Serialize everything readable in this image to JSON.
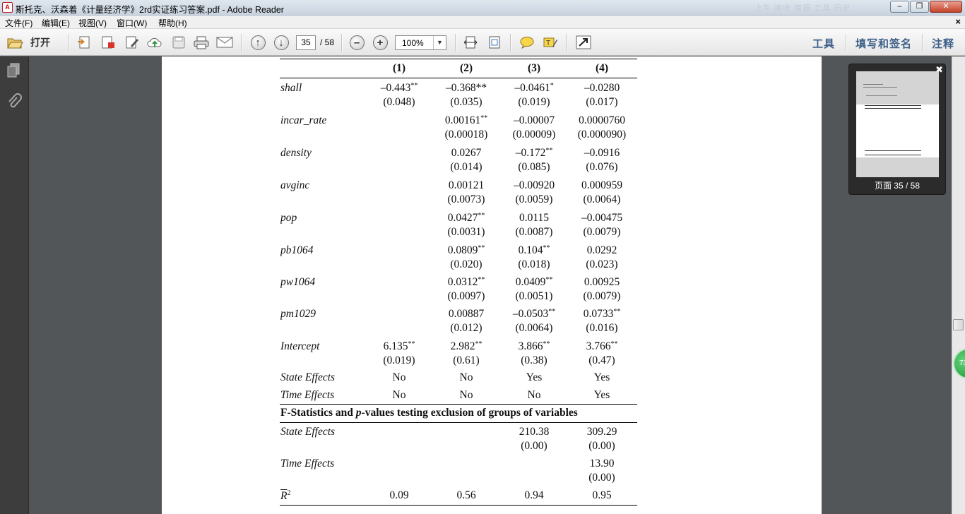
{
  "window": {
    "title": "斯托克、沃森着《计量经济学》2rd实证练习答案.pdf - Adobe Reader",
    "ghost_text": "上午 接收 简报 工具 历史"
  },
  "menu": [
    "文件(F)",
    "编辑(E)",
    "视图(V)",
    "窗口(W)",
    "帮助(H)"
  ],
  "toolbar": {
    "open_label": "打开",
    "page_current": "35",
    "page_total": "/ 58",
    "zoom": "100%",
    "tools": "工具",
    "fill_sign": "填写和签名",
    "comment": "注释"
  },
  "thumbnail": {
    "label": "页面 35 / 58"
  },
  "badge": "73",
  "table": {
    "columns": [
      "(1)",
      "(2)",
      "(3)",
      "(4)"
    ],
    "rows": [
      {
        "var": "shall",
        "c": [
          [
            "–0.443",
            "**",
            "(0.048)"
          ],
          [
            "–0.368**",
            "",
            "(0.035)"
          ],
          [
            "–0.0461",
            "*",
            "(0.019)"
          ],
          [
            "–0.0280",
            "",
            "(0.017)"
          ]
        ]
      },
      {
        "var": "incar_rate",
        "c": [
          [
            "",
            "",
            ""
          ],
          [
            "0.00161",
            "**",
            "(0.00018)"
          ],
          [
            "–0.00007",
            "",
            "(0.00009)"
          ],
          [
            "0.0000760",
            "",
            "(0.000090)"
          ]
        ]
      },
      {
        "var": "density",
        "c": [
          [
            "",
            "",
            ""
          ],
          [
            "0.0267",
            "",
            "(0.014)"
          ],
          [
            "–0.172",
            "**",
            "(0.085)"
          ],
          [
            "–0.0916",
            "",
            "(0.076)"
          ]
        ]
      },
      {
        "var": "avginc",
        "c": [
          [
            "",
            "",
            ""
          ],
          [
            "0.00121",
            "",
            "(0.0073)"
          ],
          [
            "–0.00920",
            "",
            "(0.0059)"
          ],
          [
            "0.000959",
            "",
            "(0.0064)"
          ]
        ]
      },
      {
        "var": "pop",
        "c": [
          [
            "",
            "",
            ""
          ],
          [
            "0.0427",
            "**",
            "(0.0031)"
          ],
          [
            "0.0115",
            "",
            "(0.0087)"
          ],
          [
            "–0.00475",
            "",
            "(0.0079)"
          ]
        ]
      },
      {
        "var": "pb1064",
        "c": [
          [
            "",
            "",
            ""
          ],
          [
            "0.0809",
            "**",
            "(0.020)"
          ],
          [
            "0.104",
            "**",
            "(0.018)"
          ],
          [
            "0.0292",
            "",
            "(0.023)"
          ]
        ]
      },
      {
        "var": "pw1064",
        "c": [
          [
            "",
            "",
            ""
          ],
          [
            "0.0312",
            "**",
            "(0.0097)"
          ],
          [
            "0.0409",
            "**",
            "(0.0051)"
          ],
          [
            "0.00925",
            "",
            "(0.0079)"
          ]
        ]
      },
      {
        "var": "pm1029",
        "c": [
          [
            "",
            "",
            ""
          ],
          [
            "0.00887",
            "",
            "(0.012)"
          ],
          [
            "–0.0503",
            "**",
            "(0.0064)"
          ],
          [
            "0.0733",
            "**",
            "(0.016)"
          ]
        ]
      },
      {
        "var": "Intercept",
        "c": [
          [
            "6.135",
            "**",
            "(0.019)"
          ],
          [
            "2.982",
            "**",
            "(0.61)"
          ],
          [
            "3.866",
            "**",
            "(0.38)"
          ],
          [
            "3.766",
            "**",
            "(0.47)"
          ]
        ]
      }
    ],
    "effects": [
      {
        "var": "State Effects",
        "c": [
          "No",
          "No",
          "Yes",
          "Yes"
        ]
      },
      {
        "var": "Time Effects",
        "c": [
          "No",
          "No",
          "No",
          "Yes"
        ]
      }
    ],
    "fstat_title_1": "F-Statistics and ",
    "fstat_title_p": "p",
    "fstat_title_2": "-values testing exclusion of groups of variables",
    "ftests": [
      {
        "var": "State Effects",
        "c": [
          [
            "",
            ""
          ],
          [
            "",
            ""
          ],
          [
            "210.38",
            "(0.00)"
          ],
          [
            "309.29",
            "(0.00)"
          ]
        ]
      },
      {
        "var": "Time Effects",
        "c": [
          [
            "",
            ""
          ],
          [
            "",
            ""
          ],
          [
            "",
            ""
          ],
          [
            "13.90",
            "(0.00)"
          ]
        ]
      }
    ],
    "r2_label": "R",
    "r2_sup": "2",
    "r2": [
      "0.09",
      "0.56",
      "0.94",
      "0.95"
    ]
  }
}
